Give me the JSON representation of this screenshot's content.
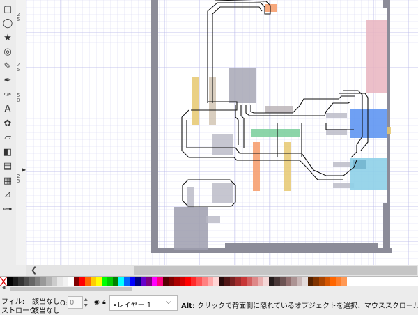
{
  "toolbox": {
    "tools": [
      {
        "name": "rectangle-tool",
        "glyph": "▢"
      },
      {
        "name": "ellipse-tool",
        "glyph": "◯"
      },
      {
        "name": "star-tool",
        "glyph": "★"
      },
      {
        "name": "spiral-tool",
        "glyph": "◎"
      },
      {
        "name": "pencil-tool",
        "glyph": "✎"
      },
      {
        "name": "pen-tool",
        "glyph": "✒"
      },
      {
        "name": "calligraphy-tool",
        "glyph": "✑"
      },
      {
        "name": "text-tool",
        "glyph": "A"
      },
      {
        "name": "spray-tool",
        "glyph": "✿"
      },
      {
        "name": "eraser-tool",
        "glyph": "▱"
      },
      {
        "name": "paint-bucket-tool",
        "glyph": "◧"
      },
      {
        "name": "gradient-tool",
        "glyph": "▤"
      },
      {
        "name": "mesh-tool",
        "glyph": "▦"
      },
      {
        "name": "dropper-tool",
        "glyph": "⊿"
      },
      {
        "name": "connector-tool",
        "glyph": "⊶"
      }
    ]
  },
  "ruler": {
    "vertical_labels": [
      "5",
      "2\n5",
      "5\n0",
      "2\n5",
      "5"
    ]
  },
  "palette": {
    "colors": [
      "#000000",
      "#1a1a1a",
      "#333333",
      "#4d4d4d",
      "#666666",
      "#808080",
      "#999999",
      "#b3b3b3",
      "#cccccc",
      "#e6e6e6",
      "#f2f2f2",
      "#ffffff",
      "#800000",
      "#ff0000",
      "#ff6600",
      "#ffcc00",
      "#ffff00",
      "#00ff00",
      "#00cc00",
      "#008000",
      "#00ffff",
      "#0066ff",
      "#0000ff",
      "#000080",
      "#6600cc",
      "#800080",
      "#ff00ff",
      "#ff0080",
      "#550000",
      "#800000",
      "#aa0000",
      "#d40000",
      "#ff0000",
      "#ff2a2a",
      "#ff5555",
      "#ff8080",
      "#ffaaaa",
      "#ffd5d5",
      "#280b0b",
      "#501616",
      "#782121",
      "#a02c2c",
      "#c83737",
      "#d35f5f",
      "#de8787",
      "#e9afaf",
      "#f4d7d7",
      "#241c1c",
      "#483737",
      "#6c5353",
      "#916f6f",
      "#ac9393",
      "#c8b7b7",
      "#e3dbdb",
      "#552200",
      "#803300",
      "#aa4400",
      "#d45500",
      "#ff6600",
      "#ff7f2a",
      "#ff9955"
    ]
  },
  "status": {
    "fill_label": "フィル:",
    "fill_value": "該当なし",
    "stroke_label": "ストローク:",
    "stroke_value": "該当なし",
    "opacity_label": "O:",
    "opacity_value": "0",
    "layer_value": "•レイヤー 1",
    "message_bold": "Alt:",
    "message": " クリックで背面側に隠れているオブジェクトを選択、マウススクロール"
  }
}
